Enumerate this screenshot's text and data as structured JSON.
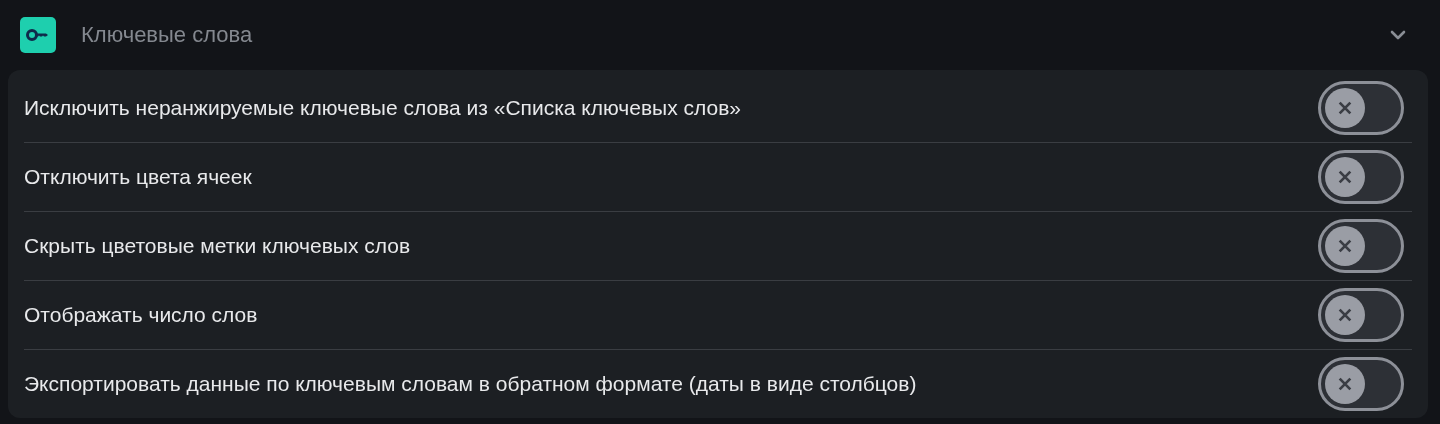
{
  "section": {
    "title": "Ключевые слова",
    "expanded": true
  },
  "settings": [
    {
      "label": "Исключить неранжируемые ключевые слова из «Списка ключевых слов»",
      "on": false
    },
    {
      "label": "Отключить цвета ячеек",
      "on": false
    },
    {
      "label": "Скрыть цветовые метки ключевых слов",
      "on": false
    },
    {
      "label": "Отображать число слов",
      "on": false
    },
    {
      "label": "Экспортировать данные по ключевым словам в обратном формате (даты в виде столбцов)",
      "on": false
    }
  ]
}
